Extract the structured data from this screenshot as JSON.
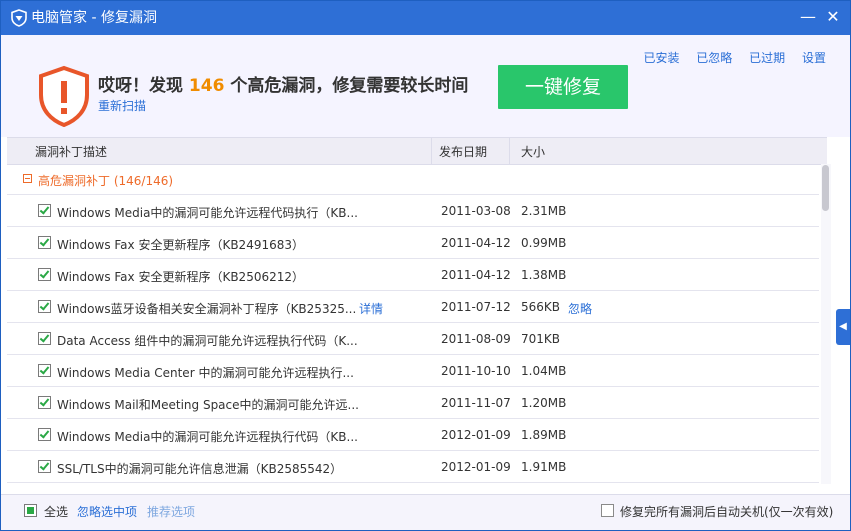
{
  "window": {
    "title": "电脑管家 - 修复漏洞",
    "min_label": "—",
    "close_label": "✕"
  },
  "header": {
    "headline_prefix": "哎呀！发现 ",
    "count": "146",
    "headline_suffix": " 个高危漏洞，修复需要较长时间",
    "rescan": "重新扫描",
    "fix_button": "一键修复",
    "links": [
      "已安装",
      "已忽略",
      "已过期",
      "设置"
    ]
  },
  "table": {
    "columns": [
      "漏洞补丁描述",
      "发布日期",
      "大小"
    ],
    "group_label": "高危漏洞补丁 (146/146)",
    "rows": [
      {
        "desc": "Windows Media中的漏洞可能允许远程代码执行（KB...",
        "date": "2011-03-08",
        "size": "2.31MB"
      },
      {
        "desc": "Windows Fax 安全更新程序（KB2491683）",
        "date": "2011-04-12",
        "size": "0.99MB"
      },
      {
        "desc": "Windows Fax 安全更新程序（KB2506212）",
        "date": "2011-04-12",
        "size": "1.38MB"
      },
      {
        "desc": "Windows蓝牙设备相关安全漏洞补丁程序（KB25325...",
        "detail": "详情",
        "date": "2011-07-12",
        "size": "566KB",
        "ignore": "忽略"
      },
      {
        "desc": "Data Access 组件中的漏洞可能允许远程执行代码（K...",
        "date": "2011-08-09",
        "size": "701KB"
      },
      {
        "desc": "Windows Media Center 中的漏洞可能允许远程执行...",
        "date": "2011-10-10",
        "size": "1.04MB"
      },
      {
        "desc": "Windows Mail和Meeting Space中的漏洞可能允许远...",
        "date": "2011-11-07",
        "size": "1.20MB"
      },
      {
        "desc": "Windows Media中的漏洞可能允许远程执行代码（KB...",
        "date": "2012-01-09",
        "size": "1.89MB"
      },
      {
        "desc": "SSL/TLS中的漏洞可能允许信息泄漏（KB2585542）",
        "date": "2012-01-09",
        "size": "1.91MB"
      }
    ]
  },
  "footer": {
    "select_all": "全选",
    "ignore_selected": "忽略选中项",
    "recommend_selected": "推荐选项",
    "auto_shutdown": "修复完所有漏洞后自动关机(仅一次有效)"
  },
  "colors": {
    "titlebar": "#2e6fd6",
    "accent_orange": "#f08c00",
    "fix_button": "#29c66b",
    "link_blue": "#2b6fd6",
    "group_orange": "#ee6b2a"
  }
}
